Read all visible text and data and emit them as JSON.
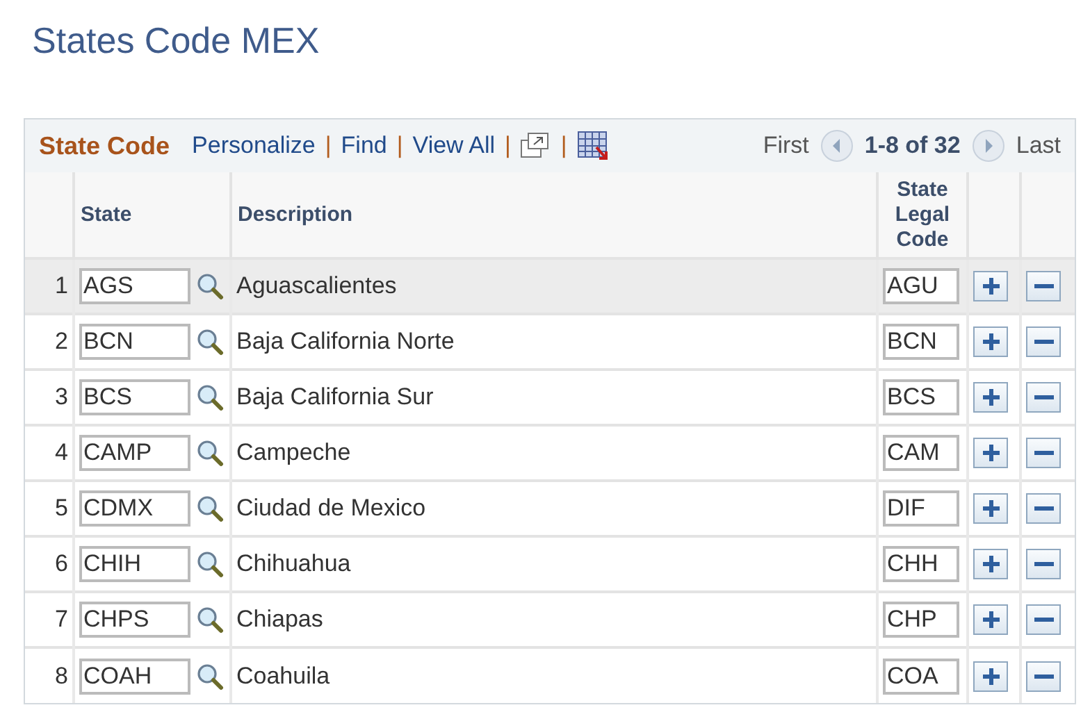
{
  "page_title": "States Code MEX",
  "grid": {
    "title": "State Code",
    "toolbar": [
      {
        "kind": "link",
        "text": "Personalize"
      },
      {
        "kind": "separator",
        "text": "|"
      },
      {
        "kind": "link",
        "text": "Find"
      },
      {
        "kind": "separator",
        "text": "|"
      },
      {
        "kind": "link",
        "text": "View All"
      },
      {
        "kind": "separator",
        "text": "|"
      },
      {
        "kind": "popout"
      },
      {
        "kind": "separator",
        "text": "|"
      },
      {
        "kind": "download"
      }
    ],
    "nav": {
      "first": "First",
      "range": "1-8 of 32",
      "last": "Last"
    },
    "columns": [
      "State",
      "Description",
      "State Legal Code"
    ],
    "rows": [
      {
        "num": "1",
        "state": "AGS",
        "description": "Aguascalientes",
        "legal_code": "AGU",
        "selected": true
      },
      {
        "num": "2",
        "state": "BCN",
        "description": "Baja California Norte",
        "legal_code": "BCN",
        "selected": false
      },
      {
        "num": "3",
        "state": "BCS",
        "description": "Baja California Sur",
        "legal_code": "BCS",
        "selected": false
      },
      {
        "num": "4",
        "state": "CAMP",
        "description": "Campeche",
        "legal_code": "CAM",
        "selected": false
      },
      {
        "num": "5",
        "state": "CDMX",
        "description": "Ciudad de Mexico",
        "legal_code": "DIF",
        "selected": false
      },
      {
        "num": "6",
        "state": "CHIH",
        "description": "Chihuahua",
        "legal_code": "CHH",
        "selected": false
      },
      {
        "num": "7",
        "state": "CHPS",
        "description": "Chiapas",
        "legal_code": "CHP",
        "selected": false
      },
      {
        "num": "8",
        "state": "COAH",
        "description": "Coahuila",
        "legal_code": "COA",
        "selected": false
      }
    ]
  }
}
